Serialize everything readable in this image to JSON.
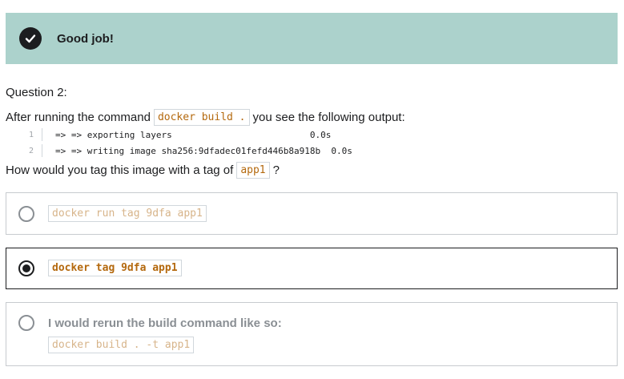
{
  "feedback": {
    "title": "Good job!",
    "icon": "check-circle-icon",
    "background": "#acd2cc"
  },
  "question": {
    "label": "Question 2:",
    "prompt_before": "After running the command",
    "prompt_code": "docker build .",
    "prompt_after": "you see the following output:",
    "code_lines": [
      {
        "num": "1",
        "text": "=> => exporting layers                          0.0s"
      },
      {
        "num": "2",
        "text": "=> => writing image sha256:9dfadec01fefd446b8a918b  0.0s"
      }
    ],
    "ask_before": "How would you tag this image with a tag of",
    "ask_code": "app1",
    "ask_after": "?"
  },
  "options": [
    {
      "code": "docker run tag 9dfa app1",
      "selected": false
    },
    {
      "code": "docker tag 9dfa app1",
      "selected": true
    },
    {
      "text": "I would rerun the build command like so:",
      "code": "docker build . -t app1",
      "selected": false
    }
  ],
  "colors": {
    "code_text": "#b4690e",
    "code_text_muted": "#d7b48a",
    "border": "#c7cbcf"
  }
}
